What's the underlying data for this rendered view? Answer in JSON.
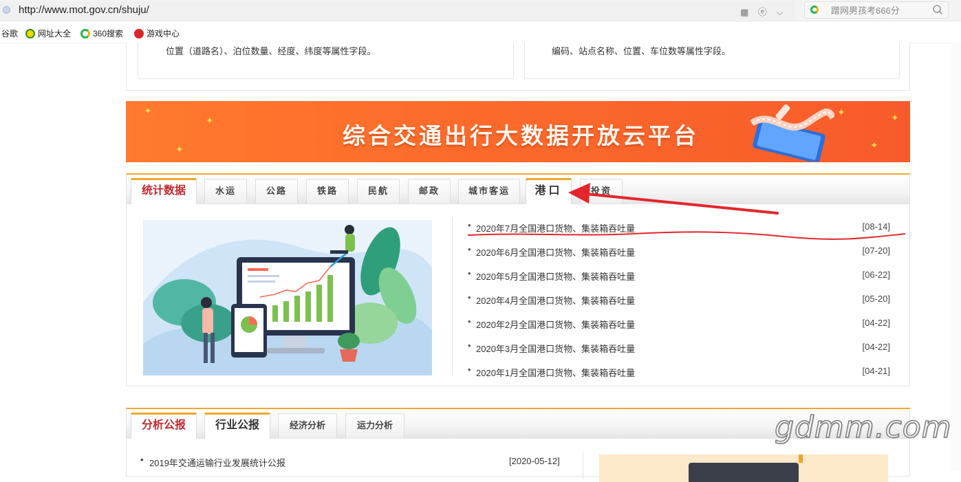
{
  "browser": {
    "url": "http://www.mot.gov.cn/shuju/",
    "search_placeholder": "蹭网男孩考666分",
    "bookmarks": [
      {
        "label": "谷歌"
      },
      {
        "label": "网址大全"
      },
      {
        "label": "360搜索"
      },
      {
        "label": "游戏中心"
      }
    ]
  },
  "top_cards": {
    "left_desc": "位置（道路名）、泊位数量、经度、纬度等属性字段。",
    "right_desc": "编码、站点名称、位置、车位数等属性字段。"
  },
  "banner": {
    "title": "综合交通出行大数据开放云平台"
  },
  "stats": {
    "tabs": [
      "统计数据",
      "水运",
      "公路",
      "铁路",
      "民航",
      "邮政",
      "城市客运",
      "港口",
      "投资"
    ],
    "active_tab": "港口",
    "news": [
      {
        "title": "2020年7月全国港口货物、集装箱吞吐量",
        "date": "[08-14]"
      },
      {
        "title": "2020年6月全国港口货物、集装箱吞吐量",
        "date": "[07-20]"
      },
      {
        "title": "2020年5月全国港口货物、集装箱吞吐量",
        "date": "[06-22]"
      },
      {
        "title": "2020年4月全国港口货物、集装箱吞吐量",
        "date": "[05-20]"
      },
      {
        "title": "2020年2月全国港口货物、集装箱吞吐量",
        "date": "[04-22]"
      },
      {
        "title": "2020年3月全国港口货物、集装箱吞吐量",
        "date": "[04-22]"
      },
      {
        "title": "2020年1月全国港口货物、集装箱吞吐量",
        "date": "[04-21]"
      }
    ]
  },
  "analysis": {
    "tabs": [
      "分析公报",
      "行业公报",
      "经济分析",
      "运力分析"
    ],
    "active_tab": "行业公报",
    "items": [
      {
        "title": "2019年交通运输行业发展统计公报",
        "date": "[2020-05-12]"
      }
    ]
  },
  "watermark": "gdmm.com",
  "colors": {
    "accent_orange": "#f0a62a",
    "tab_red": "#c0282d",
    "annotation_red": "#e3262c",
    "banner_orange": "#fb6a2b"
  }
}
